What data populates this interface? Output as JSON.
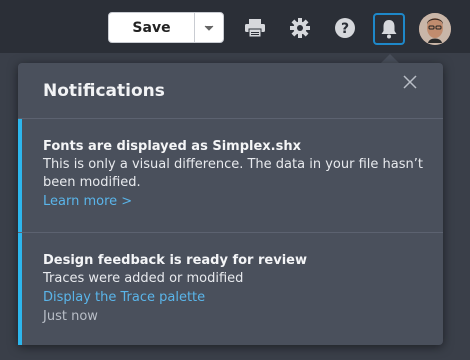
{
  "toolbar": {
    "save_label": "Save",
    "icons": [
      "chevron-down-icon",
      "print-icon",
      "gear-icon",
      "help-icon",
      "bell-icon"
    ]
  },
  "notifications_panel": {
    "title": "Notifications",
    "items": [
      {
        "title": "Fonts are displayed as Simplex.shx",
        "text": "This is only a visual difference. The data in your file hasn’t been modified.",
        "link": "Learn more >"
      },
      {
        "title": "Design feedback is ready for review",
        "text": "Traces were added or modified",
        "link": "Display the Trace palette",
        "time": "Just now"
      }
    ]
  },
  "colors": {
    "accent": "#2db6ed",
    "link": "#5ab5ea",
    "panel_bg": "#4a505c",
    "topbar_bg": "#2b2f37"
  }
}
